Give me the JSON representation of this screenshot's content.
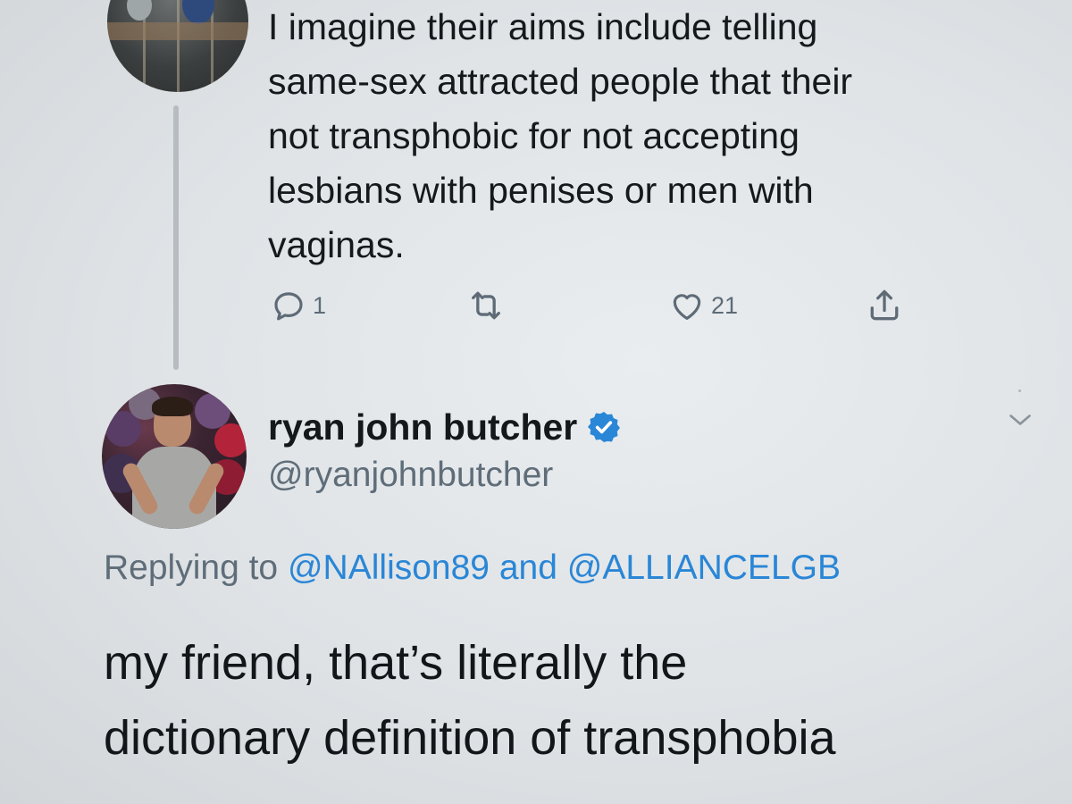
{
  "parent_tweet": {
    "text_lines": [
      "I imagine their aims include telling",
      "same-sex attracted people that their",
      "not transphobic for not accepting",
      "lesbians with penises or men with",
      "vaginas."
    ],
    "reply_count": "1",
    "retweet_count": "",
    "like_count": "21"
  },
  "reply_tweet": {
    "display_name": "ryan john butcher",
    "handle": "@ryanjohnbutcher",
    "replying_prefix": "Replying to",
    "mention_1": "@NAllison89",
    "conjunction": "and",
    "mention_2": "@ALLIANCELGB",
    "text_lines": [
      "my friend, that’s literally the",
      "dictionary definition of transphobia"
    ]
  },
  "colors": {
    "accent": "#2a86d6",
    "secondary_text": "#5f6d79",
    "icon_gray": "#5e6b77",
    "background": "#e5e9eb"
  },
  "icons": {
    "reply": "reply-icon",
    "retweet": "retweet-icon",
    "like": "like-icon",
    "share": "share-icon",
    "verified": "verified-icon",
    "more": "chevron-down-icon"
  }
}
